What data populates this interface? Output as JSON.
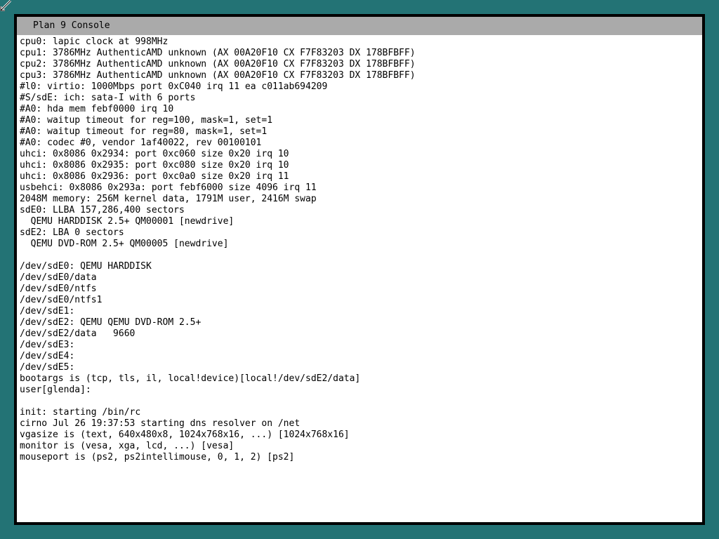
{
  "window": {
    "title": "Plan 9 Console"
  },
  "colors": {
    "desktop": "#237375",
    "titlebar": "#aaaaaa",
    "border": "#000000",
    "console_bg": "#ffffff",
    "text": "#000000"
  },
  "icons": {
    "pointer": "mouse-pointer-icon"
  },
  "console": {
    "lines": [
      "cpu0: lapic clock at 998MHz",
      "cpu1: 3786MHz AuthenticAMD unknown (AX 00A20F10 CX F7F83203 DX 178BFBFF)",
      "cpu2: 3786MHz AuthenticAMD unknown (AX 00A20F10 CX F7F83203 DX 178BFBFF)",
      "cpu3: 3786MHz AuthenticAMD unknown (AX 00A20F10 CX F7F83203 DX 178BFBFF)",
      "#l0: virtio: 1000Mbps port 0xC040 irq 11 ea c011ab694209",
      "#S/sdE: ich: sata-I with 6 ports",
      "#A0: hda mem febf0000 irq 10",
      "#A0: waitup timeout for reg=100, mask=1, set=1",
      "#A0: waitup timeout for reg=80, mask=1, set=1",
      "#A0: codec #0, vendor 1af40022, rev 00100101",
      "uhci: 0x8086 0x2934: port 0xc060 size 0x20 irq 10",
      "uhci: 0x8086 0x2935: port 0xc080 size 0x20 irq 10",
      "uhci: 0x8086 0x2936: port 0xc0a0 size 0x20 irq 11",
      "usbehci: 0x8086 0x293a: port febf6000 size 4096 irq 11",
      "2048M memory: 256M kernel data, 1791M user, 2416M swap",
      "sdE0: LLBA 157,286,400 sectors",
      "  QEMU HARDDISK 2.5+ QM00001 [newdrive]",
      "sdE2: LBA 0 sectors",
      "  QEMU DVD-ROM 2.5+ QM00005 [newdrive]",
      "",
      "/dev/sdE0: QEMU HARDDISK",
      "/dev/sdE0/data",
      "/dev/sdE0/ntfs",
      "/dev/sdE0/ntfs1",
      "/dev/sdE1:",
      "/dev/sdE2: QEMU QEMU DVD-ROM 2.5+",
      "/dev/sdE2/data   9660",
      "/dev/sdE3:",
      "/dev/sdE4:",
      "/dev/sdE5:",
      "bootargs is (tcp, tls, il, local!device)[local!/dev/sdE2/data]",
      "user[glenda]:",
      "",
      "init: starting /bin/rc",
      "cirno Jul 26 19:37:53 starting dns resolver on /net",
      "vgasize is (text, 640x480x8, 1024x768x16, ...) [1024x768x16]",
      "monitor is (vesa, xga, lcd, ...) [vesa]",
      "mouseport is (ps2, ps2intellimouse, 0, 1, 2) [ps2]"
    ]
  }
}
